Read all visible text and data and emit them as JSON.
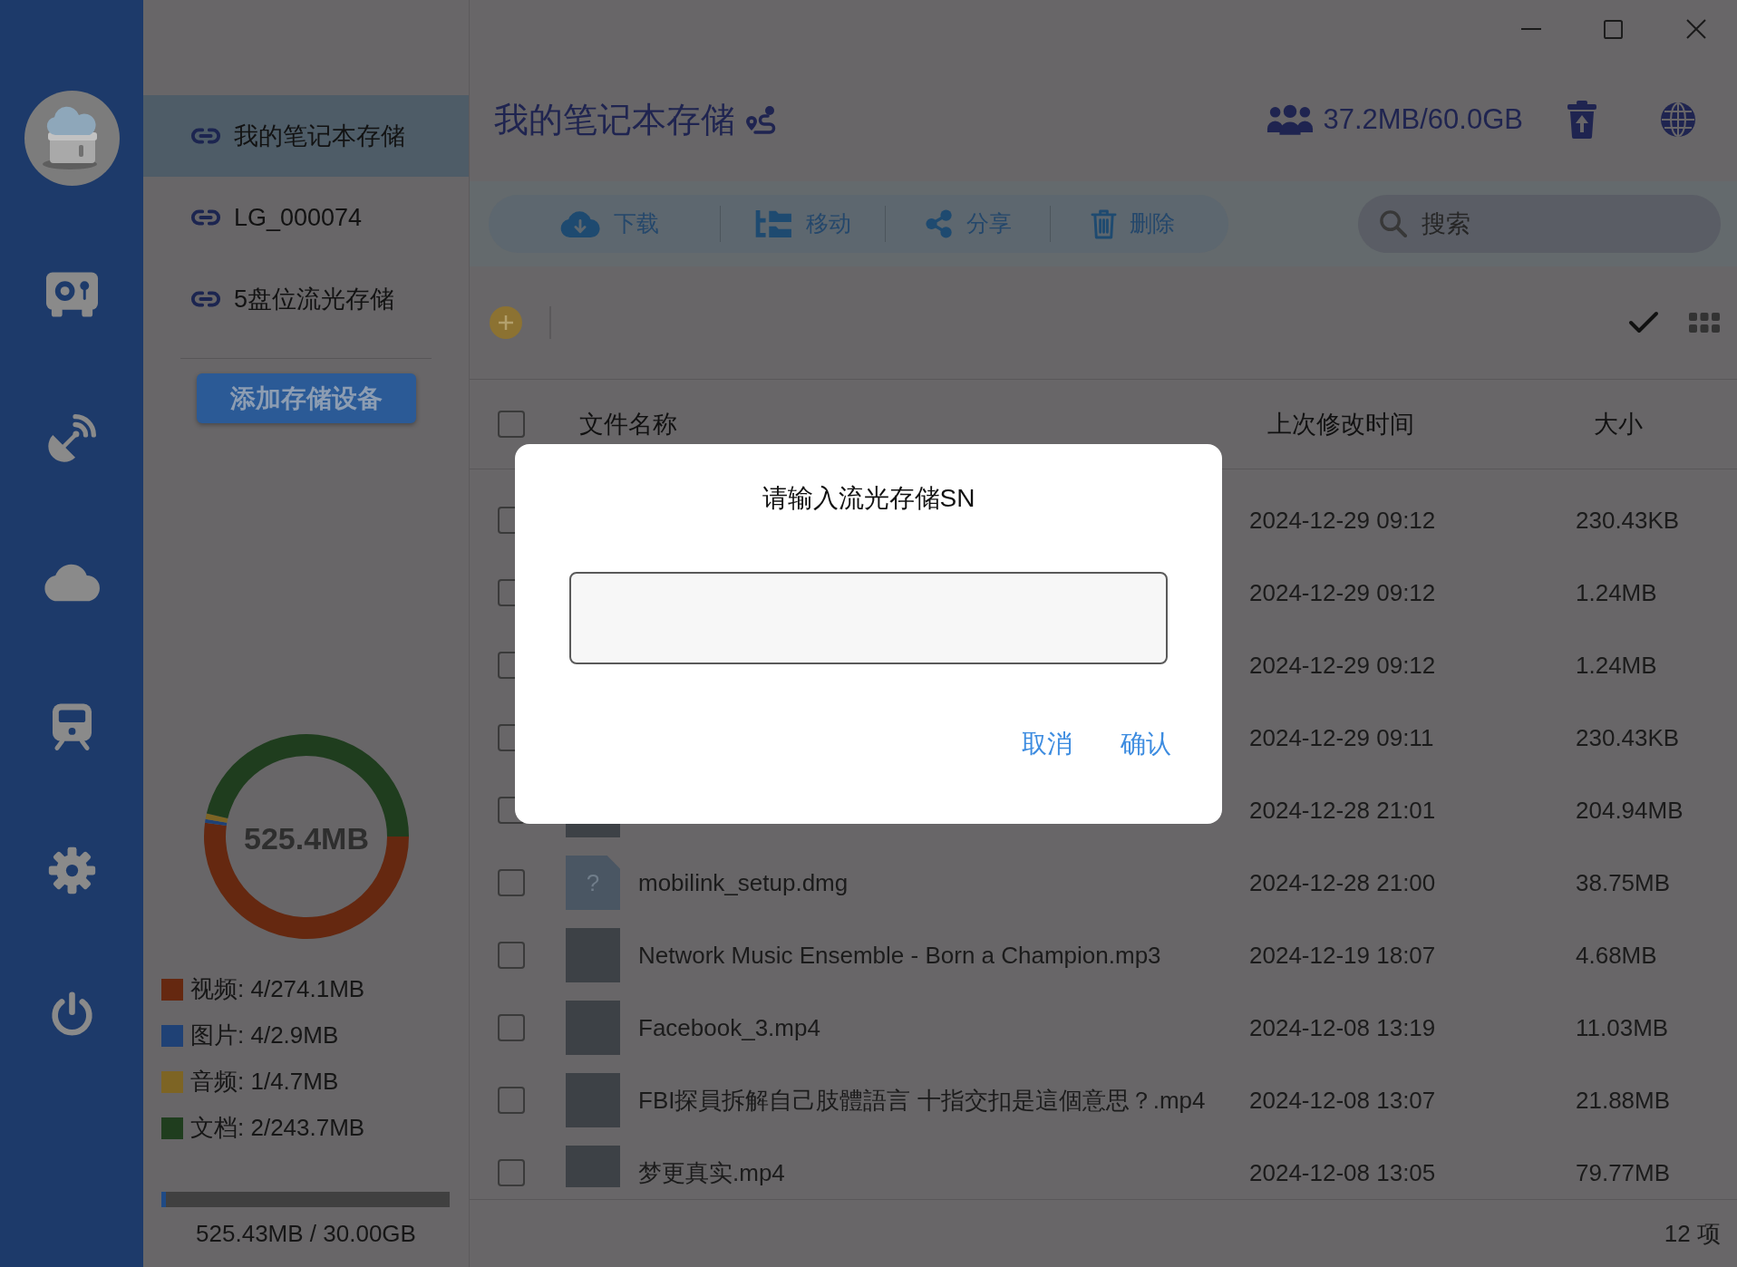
{
  "nav": [
    {
      "kind": "safe"
    },
    {
      "kind": "satellite"
    },
    {
      "kind": "cloud"
    },
    {
      "kind": "train"
    },
    {
      "kind": "settings"
    },
    {
      "kind": "power"
    }
  ],
  "devices": {
    "items": [
      {
        "label": "我的笔记本存储",
        "selected": true
      },
      {
        "label": "LG_000074",
        "selected": false
      },
      {
        "label": "5盘位流光存储",
        "selected": false
      }
    ],
    "add_button": "添加存储设备"
  },
  "storage": {
    "chart_data": {
      "type": "donut",
      "title": "525.4MB",
      "values": [
        52.17,
        0.55,
        0.89,
        46.39
      ]
    },
    "legend": [
      {
        "label": "视频: 4/274.1MB",
        "color": "#652810"
      },
      {
        "label": "图片: 4/2.9MB",
        "color": "#1f4175"
      },
      {
        "label": "音频: 1/4.7MB",
        "color": "#7d6424"
      },
      {
        "label": "文档: 2/243.7MB",
        "color": "#1f3d1e"
      }
    ],
    "usage": {
      "level": 0.017,
      "text": "525.43MB / 30.00GB"
    }
  },
  "header": {
    "title": "我的笔记本存储",
    "quota": "37.2MB/60.0GB"
  },
  "toolbar": {
    "actions": [
      {
        "kind": "download",
        "label": "下载"
      },
      {
        "kind": "move",
        "label": "移动"
      },
      {
        "kind": "share",
        "label": "分享"
      },
      {
        "kind": "delete",
        "label": "删除"
      }
    ],
    "search": {
      "placeholder": "搜索"
    }
  },
  "table": {
    "select_all": {
      "checked": false
    },
    "columns": [
      "文件名称",
      "上次修改时间",
      "大小"
    ],
    "rows": [
      {
        "modified": "2024-12-29 09:12",
        "size": "230.43KB",
        "checked": false
      },
      {
        "modified": "2024-12-29 09:12",
        "size": "1.24MB",
        "checked": false
      },
      {
        "modified": "2024-12-29 09:12",
        "size": "1.24MB",
        "checked": false
      },
      {
        "modified": "2024-12-29 09:11",
        "size": "230.43KB",
        "checked": false
      },
      {
        "thumbnail": {
          "kind": "photo"
        },
        "modified": "2024-12-28 21:01",
        "size": "204.94MB",
        "checked": false
      },
      {
        "thumbnail": {
          "kind": "file",
          "glyph": "?"
        },
        "name": "mobilink_setup.dmg",
        "modified": "2024-12-28 21:00",
        "size": "38.75MB",
        "checked": false
      },
      {
        "thumbnail": {
          "kind": "photo"
        },
        "name": "Network Music Ensemble - Born a Champion.mp3",
        "modified": "2024-12-19 18:07",
        "size": "4.68MB",
        "checked": false
      },
      {
        "thumbnail": {
          "kind": "photo"
        },
        "name": "Facebook_3.mp4",
        "modified": "2024-12-08 13:19",
        "size": "11.03MB",
        "checked": false
      },
      {
        "thumbnail": {
          "kind": "photo"
        },
        "name": "FBI探員拆解自己肢體語言 十指交扣是這個意思？.mp4",
        "modified": "2024-12-08 13:07",
        "size": "21.88MB",
        "checked": false
      },
      {
        "thumbnail": {
          "kind": "photo"
        },
        "name": "梦更真实.mp4",
        "modified": "2024-12-08 13:05",
        "size": "79.77MB",
        "checked": false
      }
    ]
  },
  "status_bar": {
    "count": "12 项"
  },
  "dialog": {
    "title": "请输入流光存储SN",
    "buttons": [
      "取消",
      "确认"
    ]
  }
}
